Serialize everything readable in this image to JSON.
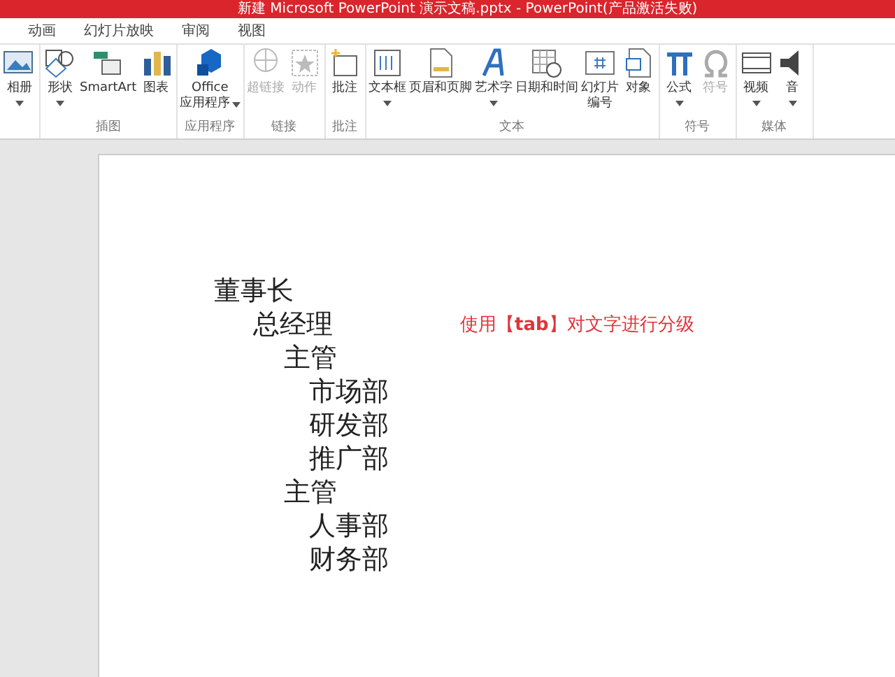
{
  "window": {
    "title": "新建 Microsoft PowerPoint 演示文稿.pptx - PowerPoint(产品激活失败)"
  },
  "tabs": [
    {
      "label": "动画",
      "selected": false
    },
    {
      "label": "幻灯片放映",
      "selected": false
    },
    {
      "label": "审阅",
      "selected": false
    },
    {
      "label": "视图",
      "selected": false
    }
  ],
  "ribbon_groups": [
    {
      "buttons": [
        {
          "label": [
            "相册"
          ],
          "dropdown": true,
          "disabled": false
        }
      ]
    },
    {
      "label": "插图",
      "buttons": [
        {
          "label": [
            "形状"
          ],
          "dropdown": true,
          "disabled": false
        },
        {
          "label": [
            "SmartArt"
          ],
          "dropdown": false,
          "disabled": false
        },
        {
          "label": [
            "图表"
          ],
          "dropdown": false,
          "disabled": false
        }
      ]
    },
    {
      "label": "应用程序",
      "buttons": [
        {
          "label": [
            "Office",
            "应用程序"
          ],
          "dropdown": true,
          "disabled": false
        }
      ]
    },
    {
      "label": "链接",
      "buttons": [
        {
          "label": [
            "超链接"
          ],
          "dropdown": false,
          "disabled": true
        },
        {
          "label": [
            "动作"
          ],
          "dropdown": false,
          "disabled": true
        }
      ]
    },
    {
      "label": "批注",
      "buttons": [
        {
          "label": [
            "批注"
          ],
          "dropdown": false,
          "disabled": false
        }
      ]
    },
    {
      "label": "文本",
      "buttons": [
        {
          "label": [
            "文本框"
          ],
          "dropdown": true,
          "disabled": false
        },
        {
          "label": [
            "页眉和页脚"
          ],
          "dropdown": false,
          "disabled": false
        },
        {
          "label": [
            "艺术字"
          ],
          "dropdown": true,
          "disabled": false
        },
        {
          "label": [
            "日期和时间"
          ],
          "dropdown": false,
          "disabled": false
        },
        {
          "label": [
            "幻灯片",
            "编号"
          ],
          "dropdown": false,
          "disabled": false
        },
        {
          "label": [
            "对象"
          ],
          "dropdown": false,
          "disabled": false
        }
      ]
    },
    {
      "label": "符号",
      "buttons": [
        {
          "label": [
            "公式"
          ],
          "dropdown": true,
          "disabled": false
        },
        {
          "label": [
            "符号"
          ],
          "dropdown": false,
          "disabled": true
        }
      ]
    },
    {
      "label": "媒体",
      "buttons": [
        {
          "label": [
            "视频"
          ],
          "dropdown": true,
          "disabled": false
        },
        {
          "label": [
            "音"
          ],
          "dropdown": true,
          "disabled": false
        }
      ]
    }
  ],
  "slide": {
    "outline": [
      {
        "text": "董事长",
        "children": [
          {
            "text": "总经理",
            "children": [
              {
                "text": "主管",
                "children": [
                  {
                    "text": "市场部"
                  },
                  {
                    "text": "研发部"
                  },
                  {
                    "text": "推广部"
                  }
                ]
              },
              {
                "text": "主管",
                "children": [
                  {
                    "text": "人事部"
                  },
                  {
                    "text": "财务部"
                  }
                ]
              }
            ]
          }
        ]
      }
    ],
    "note": "使用【**tab**】对文字进行分级"
  }
}
